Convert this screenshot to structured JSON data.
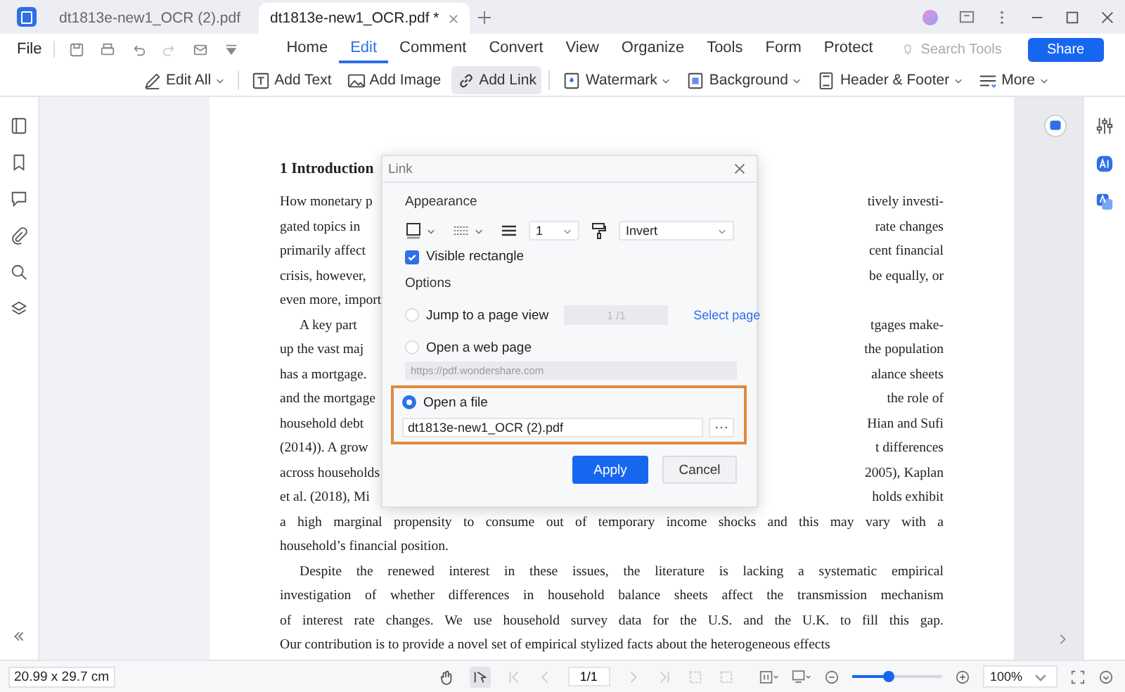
{
  "tabs": [
    {
      "label": "dt1813e-new1_OCR (2).pdf",
      "selected": false
    },
    {
      "label": "dt1813e-new1_OCR.pdf *",
      "selected": true
    }
  ],
  "menu": {
    "file": "File",
    "items": [
      {
        "label": "Home",
        "selected": false
      },
      {
        "label": "Edit",
        "selected": true
      },
      {
        "label": "Comment",
        "selected": false
      },
      {
        "label": "Convert",
        "selected": false
      },
      {
        "label": "View",
        "selected": false
      },
      {
        "label": "Organize",
        "selected": false
      },
      {
        "label": "Tools",
        "selected": false
      },
      {
        "label": "Form",
        "selected": false
      },
      {
        "label": "Protect",
        "selected": false
      }
    ],
    "search": {
      "placeholder": "Search Tools"
    },
    "share": "Share"
  },
  "toolbar": [
    {
      "label": "Edit All",
      "selected": false,
      "dropdown": true
    },
    {
      "label": "Add Text",
      "selected": false,
      "dropdown": false
    },
    {
      "label": "Add Image",
      "selected": false,
      "dropdown": false
    },
    {
      "label": "Add Link",
      "selected": true,
      "dropdown": false
    },
    {
      "label": "Watermark",
      "selected": false,
      "dropdown": true
    },
    {
      "label": "Background",
      "selected": false,
      "dropdown": true
    },
    {
      "label": "Header & Footer",
      "selected": false,
      "dropdown": true
    },
    {
      "label": "More",
      "selected": false,
      "dropdown": true
    }
  ],
  "document": {
    "heading": "1 Introduction",
    "paragraphs": [
      {
        "lines": [
          {
            "left": "How monetary p",
            "right": "tively investi-"
          },
          {
            "left": "gated topics in",
            "right": "rate changes"
          },
          {
            "left": "primarily affect",
            "right": "cent financial"
          },
          {
            "left": "crisis, however,",
            "right": "be equally, or"
          },
          {
            "left": "even more, import"
          }
        ]
      },
      {
        "lines": [
          {
            "left": "A key part",
            "right": "tgages make-"
          },
          {
            "left": "up the vast maj",
            "right": "the population"
          },
          {
            "left": "has a mortgage.",
            "right": "alance sheets"
          },
          {
            "left": "and the mortgage",
            "right": "the role of"
          },
          {
            "left": "household debt",
            "right": "Hian and Sufi"
          },
          {
            "left": "(2014)). A grow",
            "right": "t differences"
          },
          {
            "left": "across households",
            "right": "2005), Kaplan"
          },
          {
            "left": "et al. (2018), Mi",
            "right": "holds exhibit"
          },
          {
            "left": "a high marginal propensity to consume out of temporary income shocks and this may vary with a"
          },
          {
            "left": "household’s financial position."
          }
        ]
      },
      {
        "lines": [
          {
            "left": "Despite the renewed interest in these issues, the literature is lacking a systematic empirical"
          },
          {
            "left": "investigation of whether differences in household balance sheets affect the transmission mechanism"
          },
          {
            "left": "of interest rate changes. We use household survey data for the U.S. and the U.K. to fill this gap."
          },
          {
            "left": "Our contribution is to provide a novel set of empirical stylized facts about the heterogeneous effects"
          }
        ]
      }
    ]
  },
  "dialog": {
    "title": "Link",
    "appearance_heading": "Appearance",
    "width_value": "1",
    "highlight_value": "Invert",
    "visible_rectangle": {
      "label": "Visible rectangle",
      "checked": true
    },
    "options_heading": "Options",
    "options": [
      {
        "kind": "page",
        "label": "Jump to a page view",
        "selected": false,
        "highlighted": false,
        "value": "1 /1",
        "link": "Select page"
      },
      {
        "kind": "web",
        "label": "Open a web page",
        "selected": false,
        "highlighted": false,
        "placeholder": "https://pdf.wondershare.com"
      },
      {
        "kind": "file",
        "label": "Open a file",
        "selected": true,
        "highlighted": true,
        "value": "dt1813e-new1_OCR (2).pdf"
      }
    ],
    "apply": "Apply",
    "cancel": "Cancel"
  },
  "status_bar": {
    "page_size": "20.99 x 29.7 cm",
    "page": "1/1",
    "zoom_slider": {
      "level": 0.4
    },
    "zoom": "100%"
  }
}
